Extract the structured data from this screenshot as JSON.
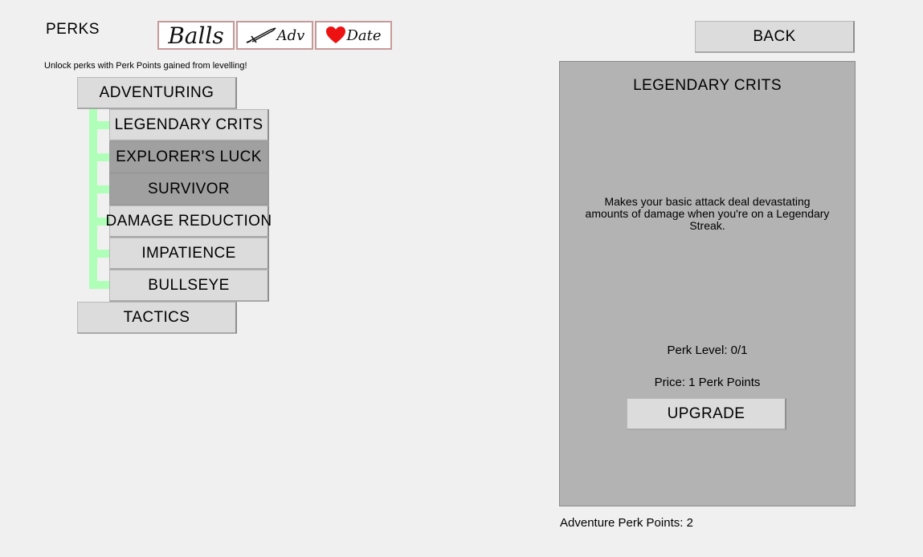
{
  "header": {
    "title": "PERKS",
    "subtitle": "Unlock perks with Perk Points gained from levelling!"
  },
  "tabs": [
    {
      "label": "Balls",
      "icon": "none"
    },
    {
      "label": "Adv",
      "icon": "sword-icon"
    },
    {
      "label": "Date",
      "icon": "heart-icon"
    }
  ],
  "colors": {
    "background": "#f0f0f0",
    "button": "#dcdcdc",
    "button_locked": "#a0a0a0",
    "panel": "#b3b3b3",
    "tree_line": "#b0ffb8",
    "tab_border": "#c79a9a",
    "heart": "#ee1111"
  },
  "categories": {
    "adventuring": "ADVENTURING",
    "tactics": "TACTICS"
  },
  "perks": [
    {
      "label": "LEGENDARY CRITS",
      "locked": false
    },
    {
      "label": "EXPLORER'S LUCK",
      "locked": true
    },
    {
      "label": "SURVIVOR",
      "locked": true
    },
    {
      "label": "DAMAGE REDUCTION",
      "locked": false
    },
    {
      "label": "IMPATIENCE",
      "locked": false
    },
    {
      "label": "BULLSEYE",
      "locked": false
    }
  ],
  "back_button": "BACK",
  "detail": {
    "title": "LEGENDARY CRITS",
    "description": "Makes your basic attack deal devastating amounts of damage when you're on a Legendary Streak.",
    "level": "Perk Level: 0/1",
    "price": "Price: 1 Perk Points",
    "upgrade_label": "UPGRADE"
  },
  "points": "Adventure Perk Points: 2"
}
